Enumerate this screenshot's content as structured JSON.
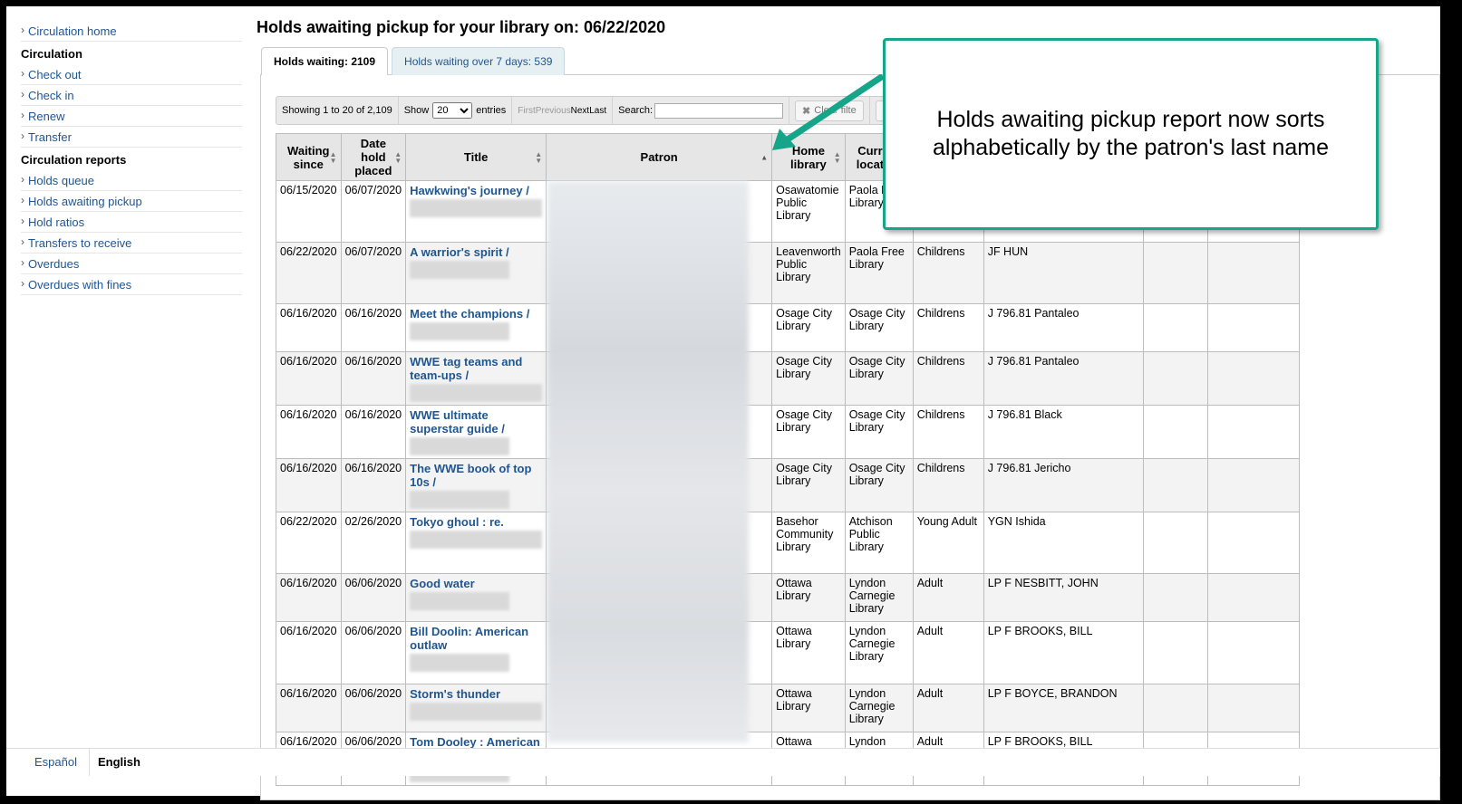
{
  "sidebar": {
    "home": "Circulation home",
    "circ_heading": "Circulation",
    "circ_items": [
      "Check out",
      "Check in",
      "Renew",
      "Transfer"
    ],
    "reports_heading": "Circulation reports",
    "report_items": [
      "Holds queue",
      "Holds awaiting pickup",
      "Hold ratios",
      "Transfers to receive",
      "Overdues",
      "Overdues with fines"
    ]
  },
  "page_title": "Holds awaiting pickup for your library on: 06/22/2020",
  "tabs": [
    {
      "label": "Holds waiting: 2109",
      "active": true
    },
    {
      "label": "Holds waiting over 7 days: 539",
      "active": false
    }
  ],
  "toolbar": {
    "showing": "Showing 1 to 20 of 2,109",
    "show_label": "Show",
    "entries_value": "20",
    "entries_label": "entries",
    "first": "First",
    "previous": "Previous",
    "next": "Next",
    "last": "Last",
    "search_label": "Search:",
    "search_value": "",
    "clear_filter": "Clear filte",
    "columns_btn": "C"
  },
  "table": {
    "headers": [
      "Waiting since",
      "Date hold placed",
      "Title",
      "Patron",
      "Home library",
      "Current location"
    ],
    "header_lines": {
      "waiting": [
        "Waiting",
        "since"
      ],
      "date": [
        "Date",
        "hold",
        "placed"
      ],
      "home": [
        "Home",
        "library"
      ],
      "current": [
        "Current",
        "location"
      ]
    },
    "rows": [
      {
        "waiting": "06/15/2020",
        "placed": "06/07/2020",
        "title": "Hawkwing's journey /",
        "home": "Osawatomie Public Library",
        "current": "Paola Free Library",
        "collection": "",
        "callnumber": ""
      },
      {
        "waiting": "06/22/2020",
        "placed": "06/07/2020",
        "title": "A warrior's spirit /",
        "home": "Leavenworth Public Library",
        "current": "Paola Free Library",
        "collection": "Childrens",
        "callnumber": "JF HUN"
      },
      {
        "waiting": "06/16/2020",
        "placed": "06/16/2020",
        "title": "Meet the champions /",
        "home": "Osage City Library",
        "current": "Osage City Library",
        "collection": "Childrens",
        "callnumber": "J 796.81 Pantaleo"
      },
      {
        "waiting": "06/16/2020",
        "placed": "06/16/2020",
        "title": "WWE tag teams and team-ups /",
        "home": "Osage City Library",
        "current": "Osage City Library",
        "collection": "Childrens",
        "callnumber": "J 796.81 Pantaleo"
      },
      {
        "waiting": "06/16/2020",
        "placed": "06/16/2020",
        "title": "WWE ultimate superstar guide /",
        "home": "Osage City Library",
        "current": "Osage City Library",
        "collection": "Childrens",
        "callnumber": "J 796.81 Black"
      },
      {
        "waiting": "06/16/2020",
        "placed": "06/16/2020",
        "title": "The WWE book of top 10s /",
        "home": "Osage City Library",
        "current": "Osage City Library",
        "collection": "Childrens",
        "callnumber": "J 796.81 Jericho"
      },
      {
        "waiting": "06/22/2020",
        "placed": "02/26/2020",
        "title": "Tokyo ghoul : re.",
        "home": "Basehor Community Library",
        "current": "Atchison Public Library",
        "collection": "Young Adult",
        "callnumber": "YGN Ishida"
      },
      {
        "waiting": "06/16/2020",
        "placed": "06/06/2020",
        "title": "Good water",
        "home": "Ottawa Library",
        "current": "Lyndon Carnegie Library",
        "collection": "Adult",
        "callnumber": "LP F NESBITT, JOHN"
      },
      {
        "waiting": "06/16/2020",
        "placed": "06/06/2020",
        "title": "Bill Doolin: American outlaw",
        "home": "Ottawa Library",
        "current": "Lyndon Carnegie Library",
        "collection": "Adult",
        "callnumber": "LP F BROOKS, BILL"
      },
      {
        "waiting": "06/16/2020",
        "placed": "06/06/2020",
        "title": "Storm's thunder",
        "home": "Ottawa Library",
        "current": "Lyndon Carnegie Library",
        "collection": "Adult",
        "callnumber": "LP F BOYCE, BRANDON"
      },
      {
        "waiting": "06/16/2020",
        "placed": "06/06/2020",
        "title": "Tom Dooley : American tragedy",
        "home": "Ottawa Library",
        "current": "Lyndon Carnegie",
        "collection": "Adult",
        "callnumber": "LP F BROOKS, BILL"
      }
    ]
  },
  "languages": {
    "es": "Español",
    "en": "English"
  },
  "callout": {
    "line1": "Holds awaiting pickup report now sorts",
    "line2": "alphabetically by the patron's last name"
  },
  "colors": {
    "accent": "#17a589",
    "link": "#1f5591"
  }
}
